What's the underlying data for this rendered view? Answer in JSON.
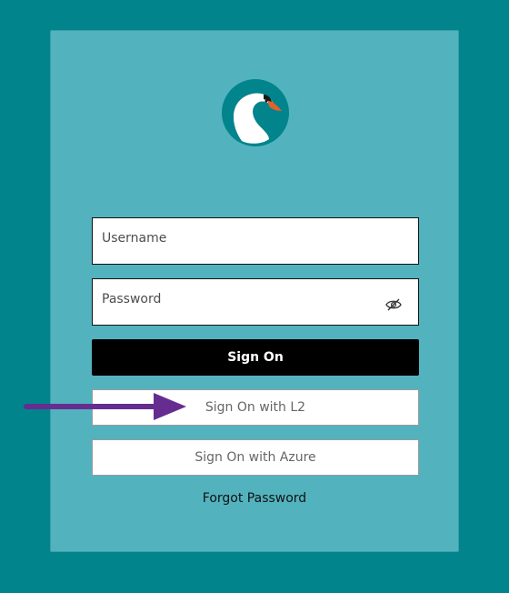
{
  "login": {
    "username_placeholder": "Username",
    "password_placeholder": "Password",
    "show_password_icon": "eye-slash-icon",
    "sign_on_label": "Sign On",
    "sign_on_l2_label": "Sign On with L2",
    "sign_on_azure_label": "Sign On with Azure",
    "forgot_password_label": "Forgot Password"
  },
  "colors": {
    "page_background": "#01848c",
    "card_background": "#52b3be",
    "primary_button": "#000000",
    "annotation_arrow": "#662d91"
  },
  "annotation": {
    "icon": "arrow-right-icon",
    "target": "Sign On with L2"
  }
}
